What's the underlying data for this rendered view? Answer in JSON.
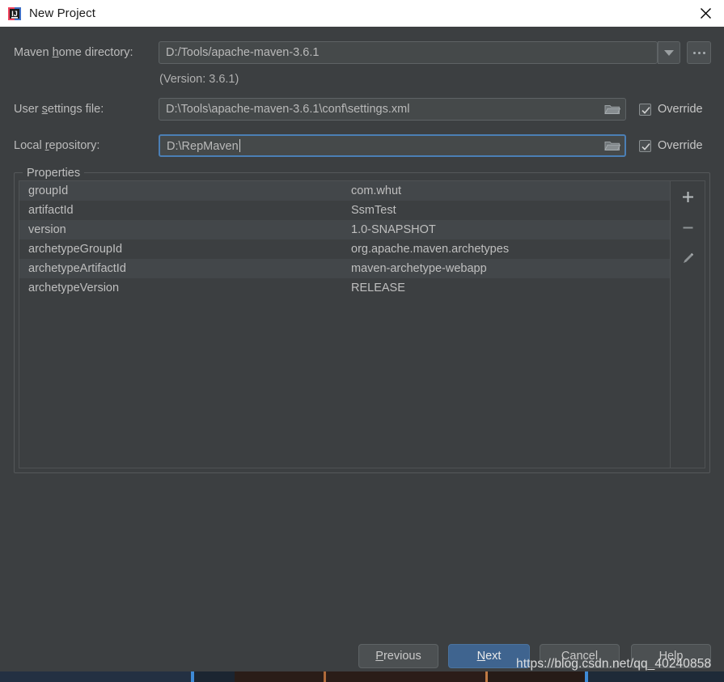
{
  "window": {
    "title": "New Project",
    "app_icon": "intellij-idea-icon",
    "close_icon": "close-icon"
  },
  "form": {
    "maven_home": {
      "label_prefix": "Maven ",
      "label_mnemonic": "h",
      "label_suffix": "ome directory:",
      "value": "D:/Tools/apache-maven-3.6.1",
      "dropdown_icon": "chevron-down-icon",
      "browse_label": "...",
      "version_note": "(Version: 3.6.1)"
    },
    "user_settings": {
      "label_prefix": "User ",
      "label_mnemonic": "s",
      "label_suffix": "ettings file:",
      "value": "D:\\Tools\\apache-maven-3.6.1\\conf\\settings.xml",
      "folder_icon": "folder-icon",
      "override_label": "Override",
      "override_checked": true
    },
    "local_repository": {
      "label_prefix": "Local ",
      "label_mnemonic": "r",
      "label_suffix": "epository:",
      "value": "D:\\RepMaven",
      "folder_icon": "folder-icon",
      "override_label": "Override",
      "override_checked": true,
      "focused": true
    }
  },
  "properties": {
    "group_title": "Properties",
    "rows": [
      {
        "key": "groupId",
        "value": "com.whut"
      },
      {
        "key": "artifactId",
        "value": "SsmTest"
      },
      {
        "key": "version",
        "value": "1.0-SNAPSHOT"
      },
      {
        "key": "archetypeGroupId",
        "value": "org.apache.maven.archetypes"
      },
      {
        "key": "archetypeArtifactId",
        "value": "maven-archetype-webapp"
      },
      {
        "key": "archetypeVersion",
        "value": "RELEASE"
      }
    ],
    "toolbar": {
      "add_icon": "plus-icon",
      "remove_icon": "minus-icon",
      "edit_icon": "pencil-icon"
    }
  },
  "buttons": {
    "previous": {
      "prefix": "",
      "mnemonic": "P",
      "suffix": "revious"
    },
    "next": {
      "prefix": "",
      "mnemonic": "N",
      "suffix": "ext"
    },
    "cancel": {
      "prefix": "Cancel",
      "mnemonic": "",
      "suffix": ""
    },
    "help": {
      "prefix": "Help",
      "mnemonic": "",
      "suffix": ""
    }
  },
  "watermark": "https://blog.csdn.net/qq_40240858",
  "colors": {
    "dialog_bg": "#3c3f41",
    "titlebar_bg": "#ffffff",
    "field_bg": "#45494a",
    "focus_border": "#4b7fb5",
    "primary_button": "#3f648f",
    "row_alt": "#43474a",
    "text": "#bfbfbf"
  }
}
